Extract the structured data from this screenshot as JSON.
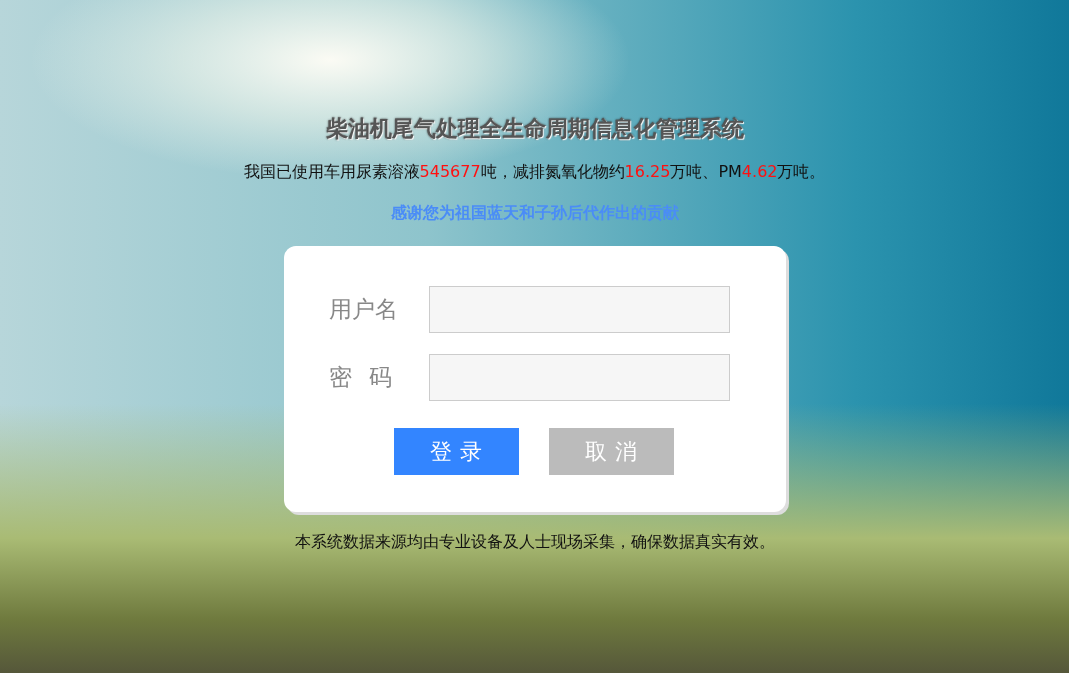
{
  "title": "柴油机尾气处理全生命周期信息化管理系统",
  "stats": [
    {
      "text": "我国已使用车用尿素溶液",
      "highlight": false
    },
    {
      "text": "545677",
      "highlight": true
    },
    {
      "text": "吨，减排氮氧化物约",
      "highlight": false
    },
    {
      "text": "16.25",
      "highlight": true
    },
    {
      "text": "万吨、PM",
      "highlight": false
    },
    {
      "text": "4.62",
      "highlight": true
    },
    {
      "text": "万吨。",
      "highlight": false
    }
  ],
  "thanks": "感谢您为祖国蓝天和子孙后代作出的贡献",
  "login_form": {
    "fields": [
      {
        "label": "用户名"
      },
      {
        "label": "密 码"
      }
    ],
    "buttons": [
      {
        "label": "登录",
        "kind": "primary"
      },
      {
        "label": "取消",
        "kind": "secondary"
      }
    ]
  },
  "footer": "本系统数据来源均由专业设备及人士现场采集，确保数据真实有效。"
}
